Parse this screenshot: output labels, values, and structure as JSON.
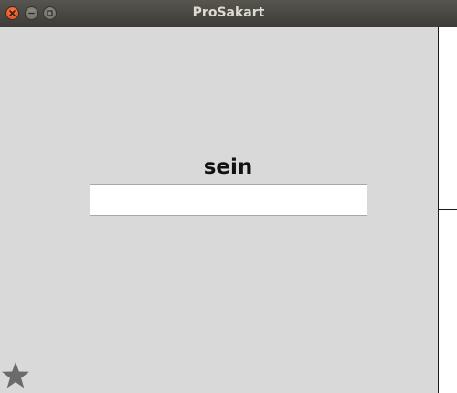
{
  "window": {
    "title": "ProSakart"
  },
  "main": {
    "word": "sein",
    "answer_value": "",
    "answer_placeholder": ""
  },
  "icons": {
    "close": "close-icon",
    "minimize": "minimize-icon",
    "maximize": "maximize-icon",
    "star": "star-icon"
  },
  "colors": {
    "titlebar": "#3d3c38",
    "close_button": "#dc4e1c",
    "background": "#d9d9d9",
    "star": "#6b6b6b"
  }
}
